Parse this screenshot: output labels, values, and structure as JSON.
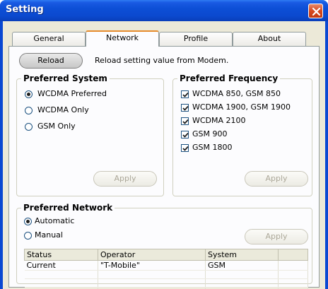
{
  "window": {
    "title": "Setting"
  },
  "tabs": [
    {
      "label": "General",
      "active": false
    },
    {
      "label": "Network",
      "active": true
    },
    {
      "label": "Profile",
      "active": false
    },
    {
      "label": "About",
      "active": false
    }
  ],
  "reload": {
    "button_label": "Reload",
    "description": "Reload setting value from Modem."
  },
  "preferred_system": {
    "title": "Preferred System",
    "options": [
      {
        "label": "WCDMA Preferred",
        "selected": true
      },
      {
        "label": "WCDMA Only",
        "selected": false
      },
      {
        "label": "GSM Only",
        "selected": false
      }
    ],
    "apply_label": "Apply"
  },
  "preferred_frequency": {
    "title": "Preferred Frequency",
    "options": [
      {
        "label": "WCDMA 850, GSM 850",
        "checked": true
      },
      {
        "label": "WCDMA 1900, GSM 1900",
        "checked": true
      },
      {
        "label": "WCDMA 2100",
        "checked": true
      },
      {
        "label": "GSM 900",
        "checked": true
      },
      {
        "label": "GSM 1800",
        "checked": true
      }
    ],
    "apply_label": "Apply"
  },
  "preferred_network": {
    "title": "Preferred Network",
    "options": [
      {
        "label": "Automatic",
        "selected": true
      },
      {
        "label": "Manual",
        "selected": false
      }
    ],
    "apply_label": "Apply",
    "table": {
      "headers": [
        "Status",
        "Operator",
        "System",
        ""
      ],
      "rows": [
        [
          "Current",
          "\"T-Mobile\"",
          "GSM",
          ""
        ]
      ]
    }
  },
  "colors": {
    "title_bar": "#0b49cf",
    "close_button": "#d7491f",
    "active_tab_accent": "#e68b2c",
    "dialog_bg": "#ece9d8",
    "radio_selected": "#21a121"
  },
  "icons": {
    "close": "close-icon",
    "checkmark": "checkmark-icon"
  }
}
